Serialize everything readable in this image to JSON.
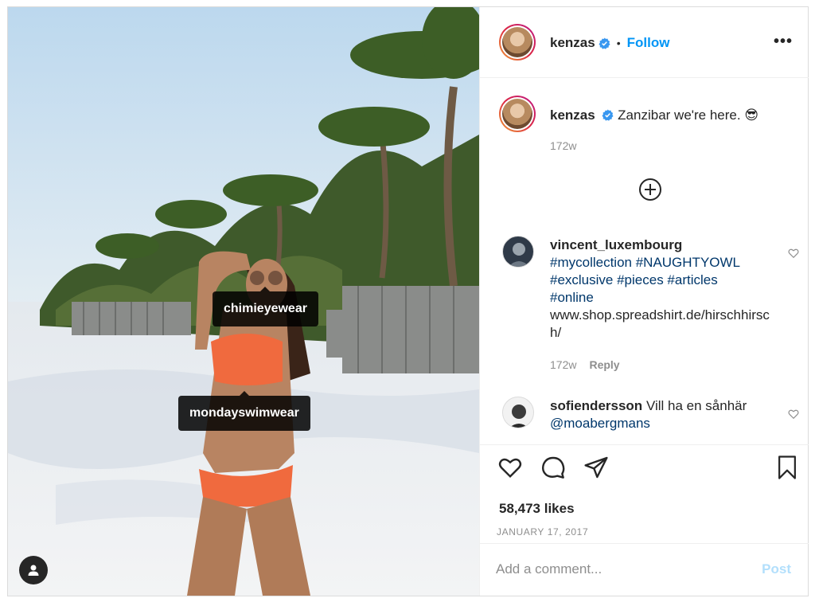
{
  "header": {
    "username": "kenzas",
    "separator": "•",
    "follow_label": "Follow",
    "more_label": "•••"
  },
  "photo": {
    "tags": [
      "chimieyewear",
      "mondayswimwear"
    ]
  },
  "caption": {
    "username": "kenzas",
    "text": "Zanzibar we're here. 😎",
    "time": "172w"
  },
  "comments": [
    {
      "username": "vincent_luxembourg",
      "lines": [
        "#mycollection #NAUGHTYOWL",
        "#exclusive #pieces #articles",
        "#online",
        "www.shop.spreadshirt.de/hirschhirsch/"
      ],
      "time": "172w",
      "reply_label": "Reply"
    },
    {
      "username": "sofiendersson",
      "text": "Vill ha en sånhär",
      "mention": "@moabergmans"
    }
  ],
  "actions": {
    "likes": "58,473 likes",
    "date": "JANUARY 17, 2017"
  },
  "composer": {
    "placeholder": "Add a comment...",
    "post_label": "Post"
  },
  "colors": {
    "accent": "#0095f6",
    "post_disabled": "#b2dffc",
    "hashtag": "#00376b",
    "muted": "#8e8e8e"
  }
}
